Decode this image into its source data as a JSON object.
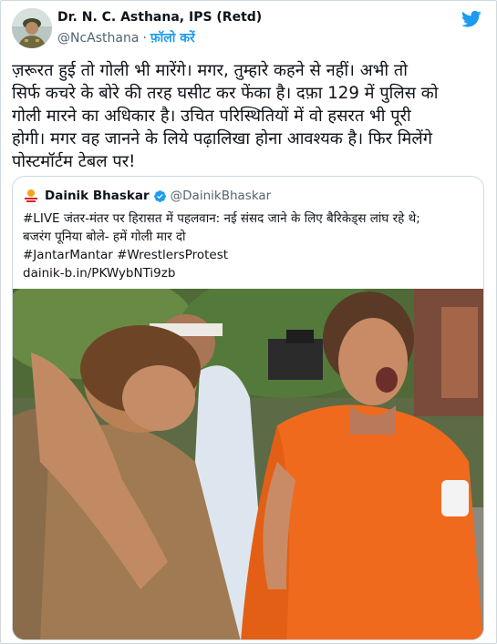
{
  "author": {
    "name": "Dr. N. C. Asthana, IPS (Retd)",
    "handle": "@NcAsthana",
    "separator": "·",
    "follow_label": "फ़ॉलो करें"
  },
  "tweet_lines": [
    "ज़रूरत हुई तो गोली भी मारेंगे। मगर, तुम्हारे कहने से नहीं। अभी तो",
    "सिर्फ कचरे के बोरे की तरह घसीट कर फेंका है। दफ़ा 129 में पुलिस को",
    "गोली मारने का अधिकार है। उचित परिस्थितियों में वो हसरत भी पूरी",
    "होगी। मगर वह जानने के लिये पढ़ालिखा होना आवश्यक है। फिर मिलेंगे",
    "पोस्टमॉर्टम टेबल पर!"
  ],
  "quoted": {
    "name": "Dainik Bhaskar",
    "handle": "@DainikBhaskar",
    "lines": [
      "#LIVE जंतर-मंतर पर हिरासत में पहलवान: नई संसद जाने के लिए बैरिकेड्स लांघ रहे थे;",
      "बजरंग पूनिया बोले- हमें गोली मार दो",
      "#JantarMantar #WrestlersProtest",
      "dainik-b.in/PKWybNTi9zb"
    ]
  },
  "colors": {
    "accent": "#1d9bf0",
    "secondary_text": "#536471",
    "border": "#cfd9de",
    "orange_shirt": "#f06a1e"
  },
  "icons": {
    "brand": "twitter-bird-icon",
    "badge": "verified-badge-icon"
  }
}
